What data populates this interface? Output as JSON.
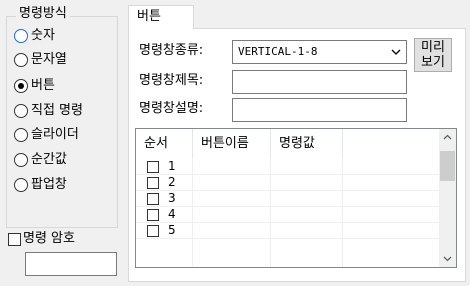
{
  "command_mode_group": {
    "title": "명령방식",
    "options": [
      {
        "label": "숫자",
        "checked": false,
        "focused": true
      },
      {
        "label": "문자열",
        "checked": false
      },
      {
        "label": "버튼",
        "checked": true
      },
      {
        "label": "직접 명령",
        "checked": false
      },
      {
        "label": "슬라이더",
        "checked": false
      },
      {
        "label": "순간값",
        "checked": false
      },
      {
        "label": "팝업창",
        "checked": false
      }
    ]
  },
  "password": {
    "label": "명령 암호",
    "value": ""
  },
  "tab": {
    "label": "버튼"
  },
  "form": {
    "window_type_label": "명령창종류:",
    "window_type_value": "VERTICAL-1-8",
    "preview_button_line1": "미리",
    "preview_button_line2": "보기",
    "window_title_label": "명령창제목:",
    "window_title_value": "",
    "window_desc_label": "명령창설명:",
    "window_desc_value": ""
  },
  "button_list": {
    "columns": [
      "순서",
      "버튼이름",
      "명령값"
    ],
    "rows": [
      {
        "order": "1",
        "name": "",
        "value": ""
      },
      {
        "order": "2",
        "name": "",
        "value": ""
      },
      {
        "order": "3",
        "name": "",
        "value": ""
      },
      {
        "order": "4",
        "name": "",
        "value": ""
      },
      {
        "order": "5",
        "name": "",
        "value": ""
      }
    ]
  },
  "icons": {
    "combo": "chevron-down-icon",
    "scroll_up": "chevron-up-icon",
    "scroll_down": "chevron-down-icon"
  },
  "colors": {
    "focus_ring": "#1a6fd8",
    "panel_bg": "#ffffff",
    "window_bg": "#f0f0f0"
  }
}
